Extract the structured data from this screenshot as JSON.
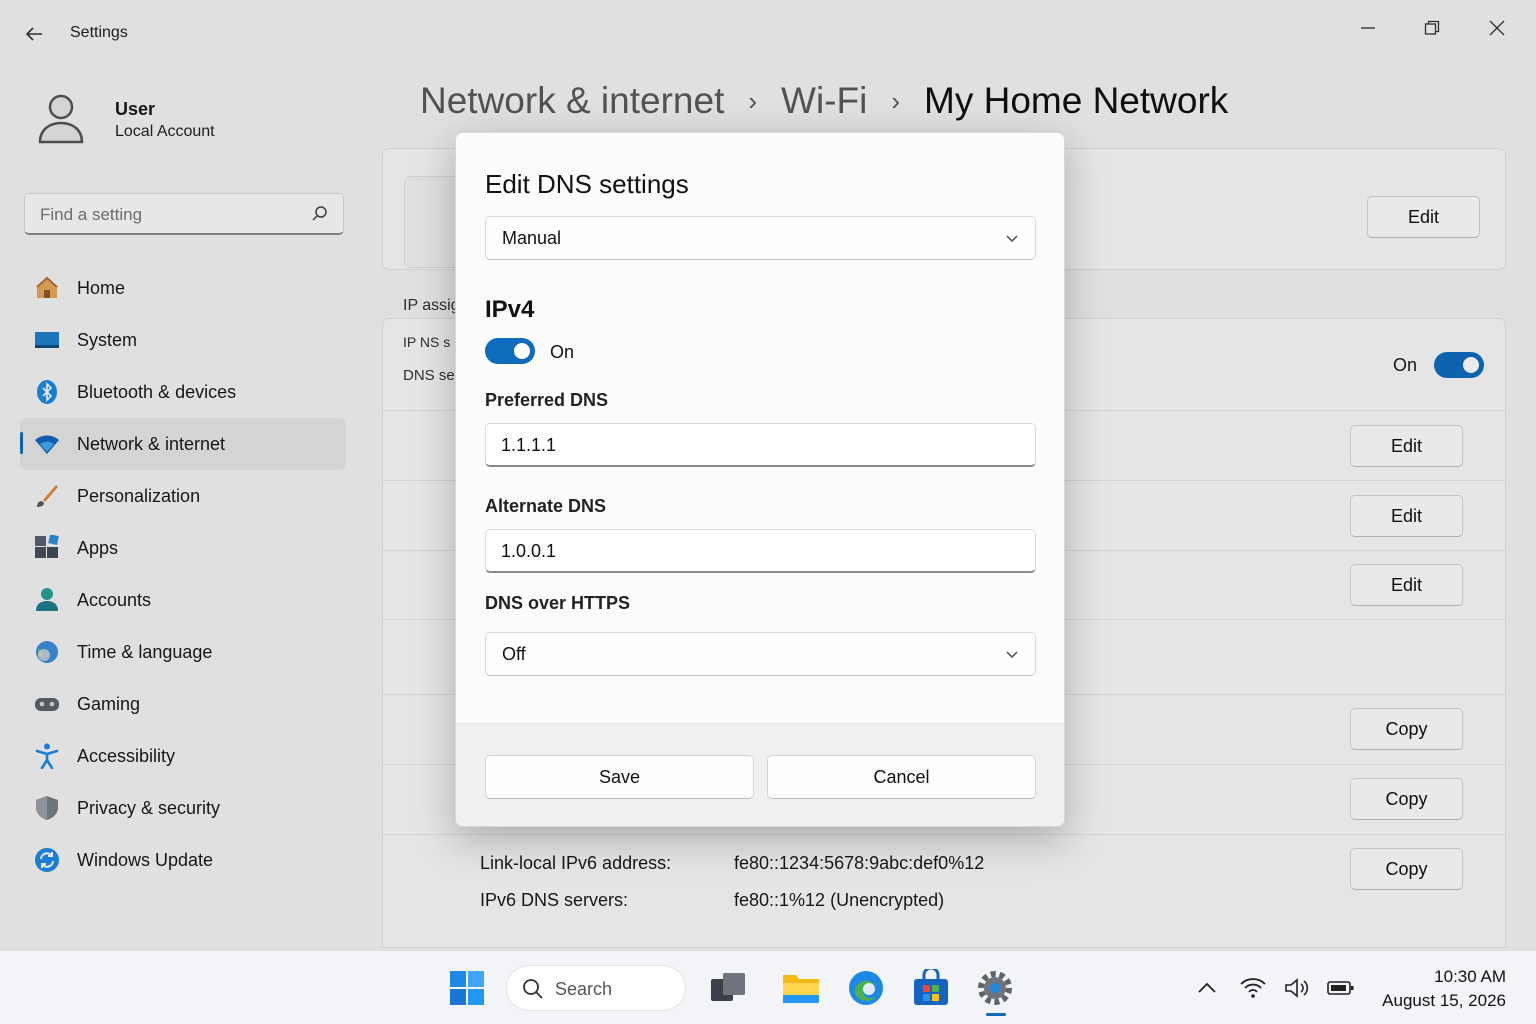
{
  "window": {
    "title": "Settings"
  },
  "user": {
    "name": "User",
    "account": "Local Account"
  },
  "search": {
    "placeholder": "Find a setting"
  },
  "nav": [
    {
      "label": "Home",
      "icon": "home-icon"
    },
    {
      "label": "System",
      "icon": "system-icon"
    },
    {
      "label": "Bluetooth & devices",
      "icon": "bluetooth-icon"
    },
    {
      "label": "Network & internet",
      "icon": "wifi-icon",
      "selected": true
    },
    {
      "label": "Personalization",
      "icon": "brush-icon"
    },
    {
      "label": "Apps",
      "icon": "apps-icon"
    },
    {
      "label": "Accounts",
      "icon": "accounts-icon"
    },
    {
      "label": "Time & language",
      "icon": "globe-icon"
    },
    {
      "label": "Gaming",
      "icon": "gamepad-icon"
    },
    {
      "label": "Accessibility",
      "icon": "accessibility-icon"
    },
    {
      "label": "Privacy & security",
      "icon": "shield-icon"
    },
    {
      "label": "Windows Update",
      "icon": "update-icon"
    }
  ],
  "breadcrumb": {
    "parts": [
      "Network & internet",
      "Wi-Fi",
      "My Home Network"
    ],
    "separator": "›"
  },
  "background": {
    "edit_label": "Edit",
    "copy_label": "Copy",
    "ip_assignment_label": "IP assig",
    "ip_dns_label": "IP NS s",
    "dns_server_label": "DNS se",
    "toggle_label": "On",
    "ipv6_rows": [
      {
        "label": "Link-local IPv6 address:",
        "value": "fe80::1234:5678:9abc:def0%12"
      },
      {
        "label": "IPv6 DNS servers:",
        "value": "fe80::1%12 (Unencrypted)"
      }
    ]
  },
  "dialog": {
    "title": "Edit DNS settings",
    "mode": "Manual",
    "section": "IPv4",
    "ipv4_toggle": "On",
    "preferred_label": "Preferred DNS",
    "preferred_value": "1.1.1.1",
    "alternate_label": "Alternate DNS",
    "alternate_value": "1.0.0.1",
    "doh_label": "DNS over HTTPS",
    "doh_value": "Off",
    "save": "Save",
    "cancel": "Cancel"
  },
  "taskbar": {
    "search": "Search",
    "time": "10:30 AM",
    "date": "August 15, 2026"
  },
  "colors": {
    "accent": "#0f6cbd"
  }
}
